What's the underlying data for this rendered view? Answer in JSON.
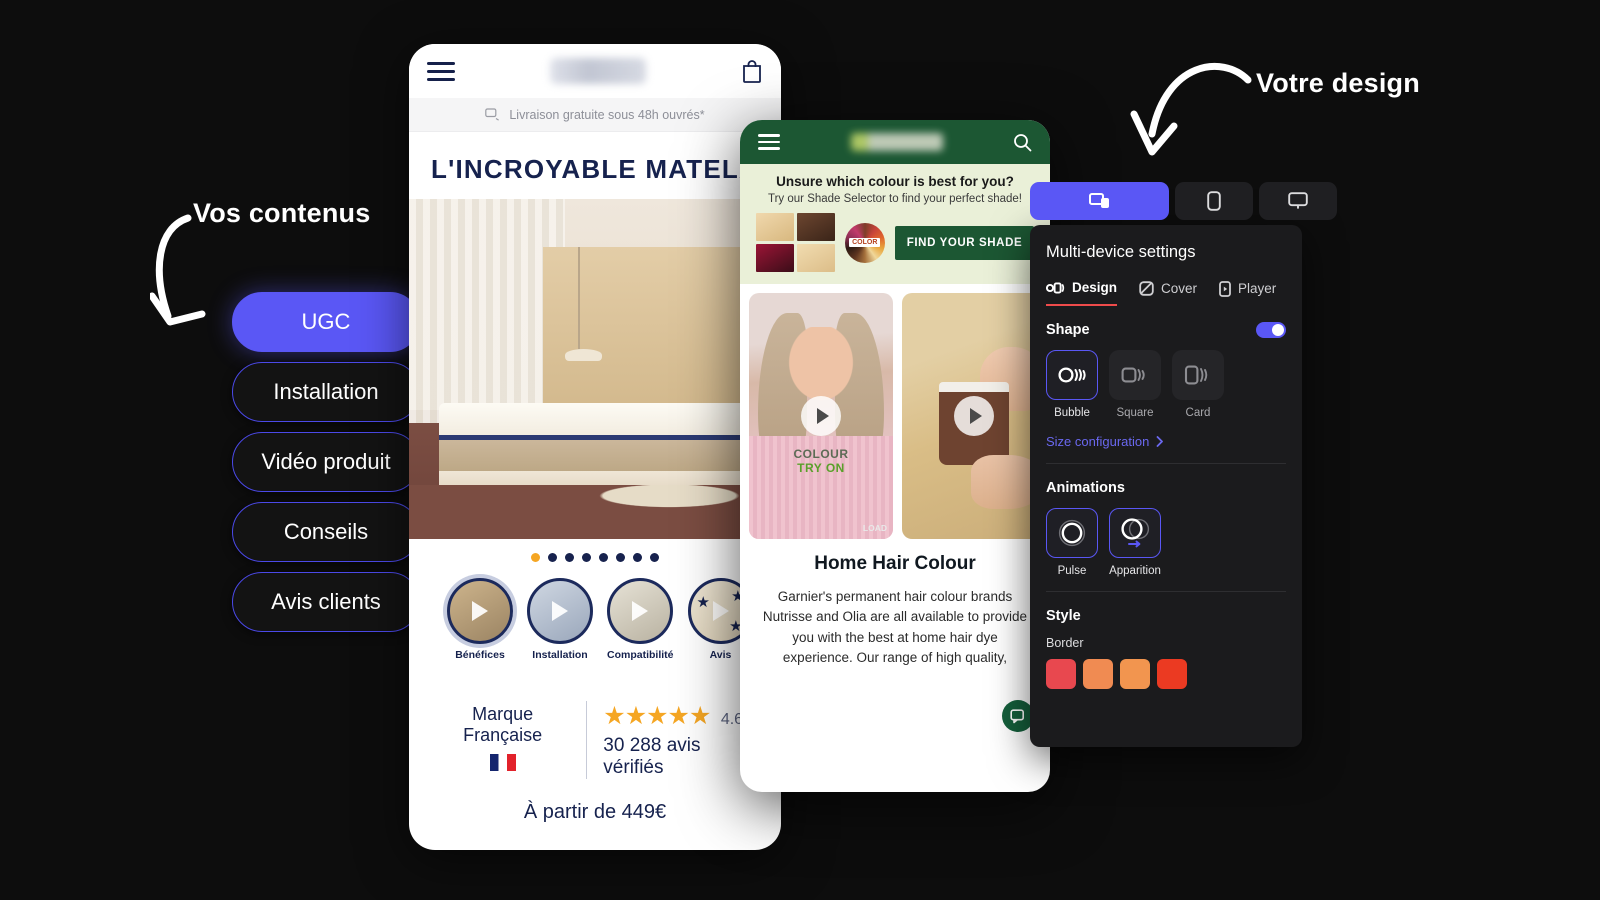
{
  "annotations": {
    "left_label": "Vos contenus",
    "right_label": "Votre design"
  },
  "content_pills": {
    "items": [
      {
        "label": "UGC",
        "active": true
      },
      {
        "label": "Installation",
        "active": false
      },
      {
        "label": "Vidéo produit",
        "active": false
      },
      {
        "label": "Conseils",
        "active": false
      },
      {
        "label": "Avis clients",
        "active": false
      }
    ],
    "active_color": "#5a57f5",
    "border_color": "#4b49e8"
  },
  "phone_mattress": {
    "topbar": {
      "menu_icon": "hamburger-icon",
      "cart_icon": "shopping-bag-icon"
    },
    "promo_bar": {
      "icon": "delivery-truck-icon",
      "text": "Livraison gratuite sous 48h ouvrés*"
    },
    "page_title": "L'INCROYABLE MATELA",
    "carousel": {
      "dots": 8,
      "active_index": 0,
      "active_dot_color": "#f5a623",
      "dot_color": "#17224e"
    },
    "video_stories": [
      {
        "label": "Bénéfices"
      },
      {
        "label": "Installation"
      },
      {
        "label": "Compatibilité"
      },
      {
        "label": "Avis"
      }
    ],
    "reviews": {
      "brand_label": "Marque Française",
      "flag_icon": "french-flag-icon",
      "stars": "★★★★★",
      "rating": "4.6",
      "count_text": "30 288 avis vérifiés",
      "chevron_icon": "chevron-right-icon"
    },
    "price_text": "À partir de 449€"
  },
  "phone_garnier": {
    "topbar": {
      "menu_icon": "hamburger-icon",
      "search_icon": "search-icon"
    },
    "shade_banner": {
      "heading": "Unsure which colour is best for you?",
      "subheading": "Try our Shade Selector to find your perfect shade!",
      "wheel_label": "COLOR",
      "cta": "FIND YOUR SHADE",
      "swatches": [
        "#e8cfa6",
        "#5e3b29",
        "#8e1b35",
        "#e9d3a8"
      ]
    },
    "videos": [
      {
        "overlay_title": "COLOUR",
        "overlay_title2": "TRY ON",
        "loading_text": "LOAD",
        "play_icon": "play-icon"
      },
      {
        "play_icon": "play-icon"
      }
    ],
    "article": {
      "title": "Home Hair Colour",
      "body": "Garnier's permanent hair colour brands Nutrisse and Olia are all available to provide you with the best at home hair dye experience. Our range of high quality,"
    },
    "chat_button": {
      "icon": "chat-bubble-icon",
      "color": "#15603c"
    }
  },
  "settings_panel": {
    "device_tabs": [
      {
        "icon": "multi-device-icon",
        "active": true
      },
      {
        "icon": "mobile-icon",
        "active": false
      },
      {
        "icon": "desktop-icon",
        "active": false
      }
    ],
    "title": "Multi-device settings",
    "tabs": [
      {
        "label": "Design",
        "icon": "design-icon",
        "active": true
      },
      {
        "label": "Cover",
        "icon": "cover-icon",
        "active": false
      },
      {
        "label": "Player",
        "icon": "player-icon",
        "active": false
      }
    ],
    "active_tab_underline_color": "#ef4b4b",
    "shape": {
      "heading": "Shape",
      "toggle_on": true,
      "options": [
        {
          "label": "Bubble",
          "icon": "bubble-shape-icon",
          "selected": true
        },
        {
          "label": "Square",
          "icon": "square-shape-icon",
          "selected": false
        },
        {
          "label": "Card",
          "icon": "card-shape-icon",
          "selected": false
        }
      ],
      "size_configuration_label": "Size configuration",
      "size_configuration_chevron": "chevron-right-icon",
      "link_color": "#6a68ef"
    },
    "animations": {
      "heading": "Animations",
      "options": [
        {
          "label": "Pulse",
          "icon": "pulse-animation-icon",
          "selected": true
        },
        {
          "label": "Apparition",
          "icon": "apparition-animation-icon",
          "selected": true
        }
      ]
    },
    "style": {
      "heading": "Style",
      "border_label": "Border",
      "border_colors": [
        "#e8484f",
        "#f08b52",
        "#f2954f",
        "#eb3a22"
      ]
    }
  }
}
